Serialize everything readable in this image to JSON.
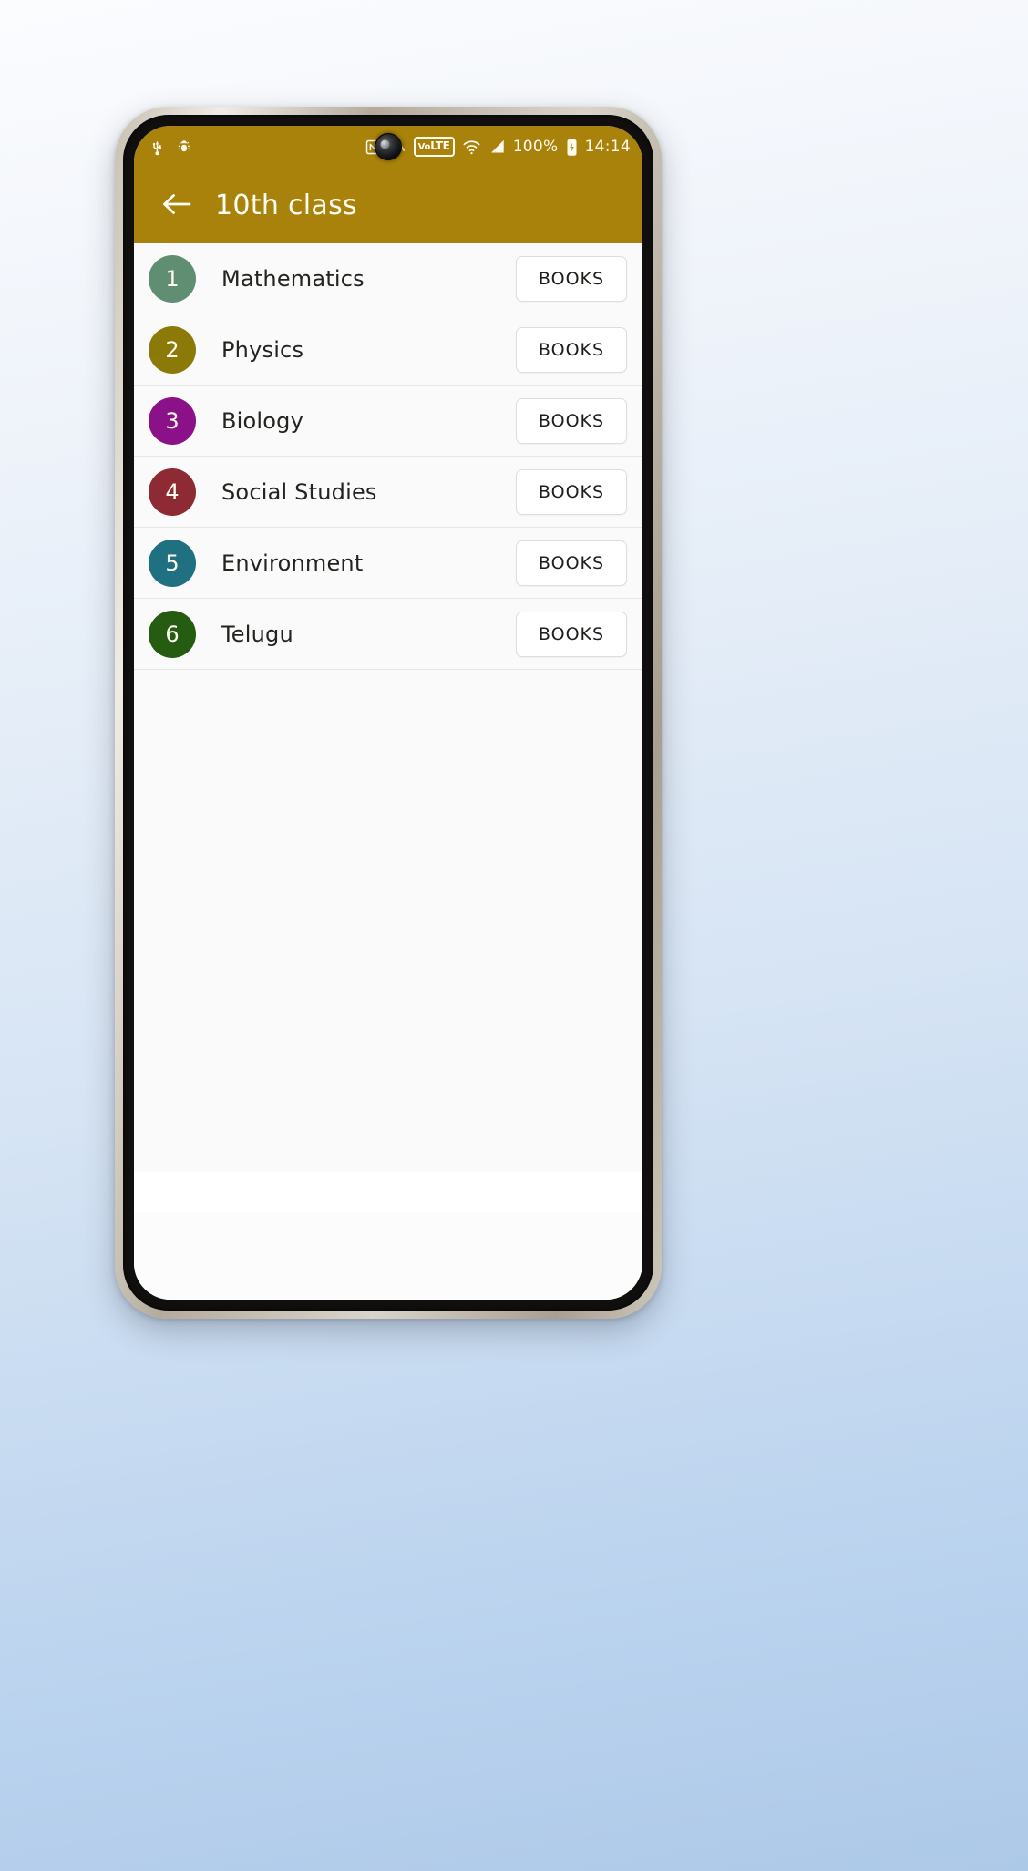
{
  "status_bar": {
    "left_icons": [
      {
        "name": "usb-icon",
        "glyph": "usb"
      },
      {
        "name": "android-debug-bug-icon",
        "glyph": "bug"
      }
    ],
    "right_icons": [
      {
        "name": "nfc-icon",
        "glyph": "nfc"
      },
      {
        "name": "mute-icon",
        "glyph": "mute"
      }
    ],
    "volte_label": "VoLTE",
    "volte_prefix": "Vo",
    "volte_suffix": "LTE",
    "battery_percent": "100%",
    "time": "14:14",
    "background_color": "#a8820a"
  },
  "app_bar": {
    "back_icon": "arrow-left-icon",
    "title": "10th class",
    "background_color": "#a8820a",
    "text_color": "#fffdf5"
  },
  "list": {
    "action_label": "BOOKS",
    "items": [
      {
        "index": "1",
        "name": "Mathematics",
        "color": "#5f8e72",
        "action": "BOOKS"
      },
      {
        "index": "2",
        "name": "Physics",
        "color": "#8b7a08",
        "action": "BOOKS"
      },
      {
        "index": "3",
        "name": "Biology",
        "color": "#8a1188",
        "action": "BOOKS"
      },
      {
        "index": "4",
        "name": "Social Studies",
        "color": "#8d2a33",
        "action": "BOOKS"
      },
      {
        "index": "5",
        "name": "Environment",
        "color": "#1f7181",
        "action": "BOOKS"
      },
      {
        "index": "6",
        "name": "Telugu",
        "color": "#255c12",
        "action": "BOOKS"
      }
    ]
  }
}
